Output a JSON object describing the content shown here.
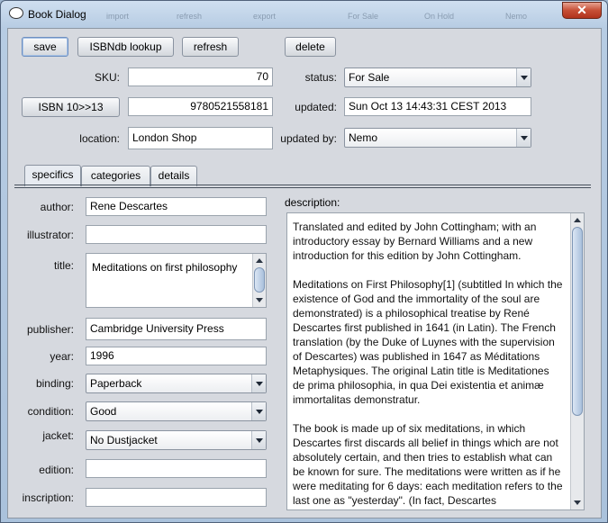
{
  "window": {
    "title": "Book Dialog",
    "close_label": "✕",
    "ghost_titles": [
      "import",
      "refresh",
      "export",
      "For Sale",
      "On Hold",
      "Nemo"
    ]
  },
  "toolbar": {
    "save": "save",
    "isbndb": "ISBNdb lookup",
    "refresh": "refresh",
    "delete": "delete"
  },
  "form": {
    "sku_label": "SKU:",
    "sku_value": "70",
    "status_label": "status:",
    "status_value": "For Sale",
    "isbn_button": "ISBN 10>>13",
    "isbn_value": "9780521558181",
    "updated_label": "updated:",
    "updated_value": "Sun Oct 13 14:43:31 CEST 2013",
    "location_label": "location:",
    "location_value": "London Shop",
    "updated_by_label": "updated by:",
    "updated_by_value": "Nemo"
  },
  "tabs": [
    "specifics",
    "categories",
    "details"
  ],
  "specifics": {
    "author_label": "author:",
    "author_value": "Rene Descartes",
    "illustrator_label": "illustrator:",
    "illustrator_value": "",
    "title_label": "title:",
    "title_value": "Meditations on first philosophy",
    "publisher_label": "publisher:",
    "publisher_value": "Cambridge University Press",
    "year_label": "year:",
    "year_value": "1996",
    "binding_label": "binding:",
    "binding_value": "Paperback",
    "condition_label": "condition:",
    "condition_value": "Good",
    "jacket_label": "jacket:",
    "jacket_value": "No Dustjacket",
    "edition_label": "edition:",
    "edition_value": "",
    "inscription_label": "inscription:",
    "inscription_value": "",
    "description_label": "description:",
    "description_paragraphs": [
      "Translated and edited by John Cottingham; with an introductory essay by Bernard Williams and a new introduction for this edition by John Cottingham.",
      "Meditations on First Philosophy[1] (subtitled In which the existence of God and the immortality of the soul are demonstrated) is a philosophical treatise by René Descartes first published in 1641 (in Latin). The French translation (by the Duke of Luynes with the supervision of Descartes) was published in 1647 as Méditations Metaphysiques. The original Latin title is Meditationes de prima philosophia, in qua Dei existentia et animæ immortalitas demonstratur.",
      "The book is made up of six meditations, in which Descartes first discards all belief in things which are not absolutely certain, and then tries to establish what can be known for sure. The meditations were written as if he were meditating for 6 days: each meditation refers to the last one as \"yesterday\". (In fact, Descartes"
    ]
  }
}
